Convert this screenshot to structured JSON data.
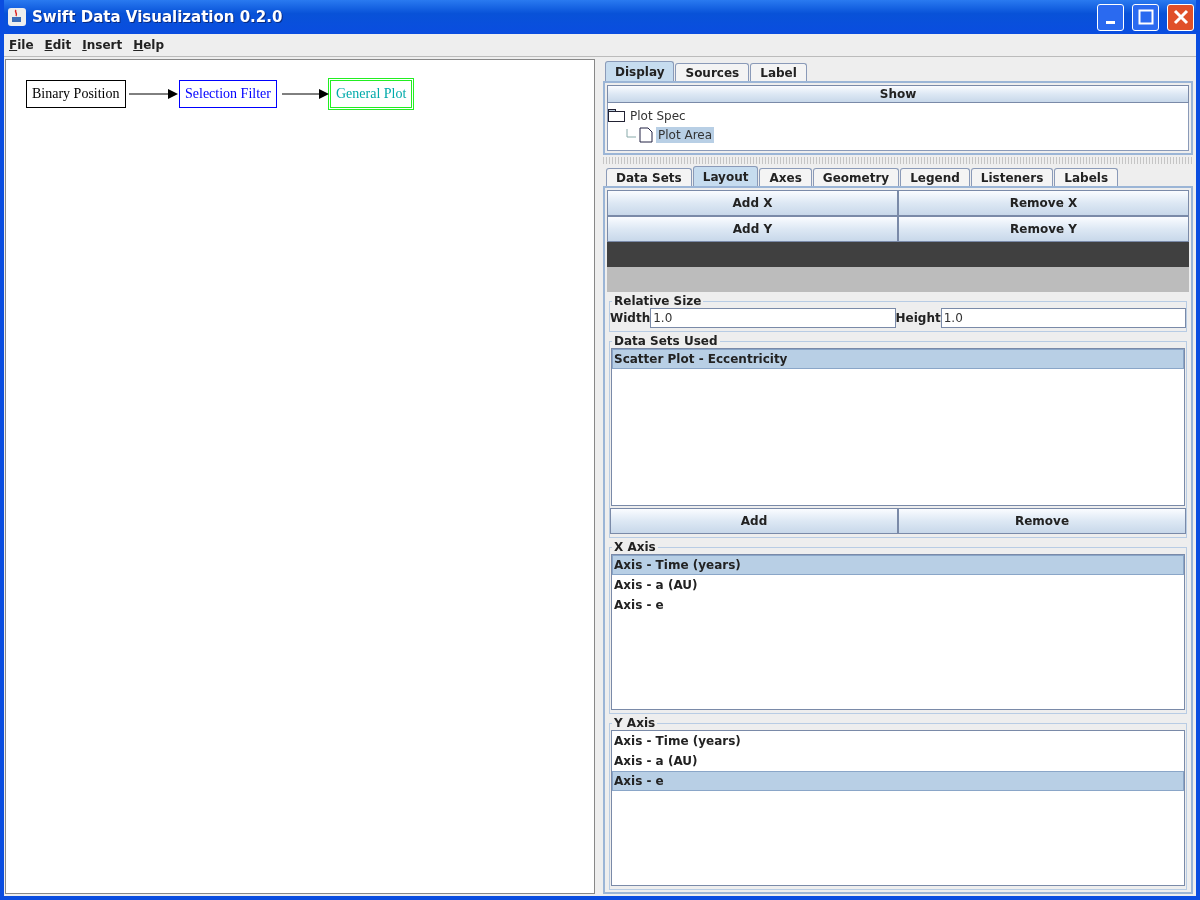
{
  "window": {
    "title": "Swift Data Visualization 0.2.0"
  },
  "menu": [
    "File",
    "Edit",
    "Insert",
    "Help"
  ],
  "diagram": {
    "nodes": [
      {
        "label": "Binary Position",
        "color": "#000000",
        "selected": false
      },
      {
        "label": "Selection Filter",
        "color": "#0000ff",
        "selected": false
      },
      {
        "label": "General Plot",
        "color": "#00aaaa",
        "selected": true
      }
    ]
  },
  "top_tabs": [
    {
      "label": "Display",
      "selected": true
    },
    {
      "label": "Sources",
      "selected": false
    },
    {
      "label": "Label",
      "selected": false
    }
  ],
  "show_button": "Show",
  "tree": [
    {
      "label": "Plot Spec",
      "selected": false,
      "children": [
        {
          "label": "Plot Area",
          "selected": true
        }
      ]
    }
  ],
  "inner_tabs": [
    {
      "label": "Data Sets",
      "selected": false
    },
    {
      "label": "Layout",
      "selected": true
    },
    {
      "label": "Axes",
      "selected": false
    },
    {
      "label": "Geometry",
      "selected": false
    },
    {
      "label": "Legend",
      "selected": false
    },
    {
      "label": "Listeners",
      "selected": false
    },
    {
      "label": "Labels",
      "selected": false
    }
  ],
  "axis_buttons": [
    "Add X",
    "Remove X",
    "Add Y",
    "Remove Y"
  ],
  "relative_size": {
    "title": "Relative Size",
    "fields": [
      {
        "label": "Width",
        "value": "1.0"
      },
      {
        "label": "Height",
        "value": "1.0"
      }
    ]
  },
  "data_sets_used": {
    "title": "Data Sets Used",
    "items": [
      {
        "label": "Scatter Plot - Eccentricity",
        "selected": true
      }
    ],
    "buttons": [
      "Add",
      "Remove"
    ]
  },
  "x_axis": {
    "title": "X Axis",
    "items": [
      {
        "label": "Axis - Time (years)",
        "selected": true
      },
      {
        "label": "Axis - a (AU)",
        "selected": false
      },
      {
        "label": "Axis - e",
        "selected": false
      }
    ]
  },
  "y_axis": {
    "title": "Y Axis",
    "items": [
      {
        "label": "Axis - Time (years)",
        "selected": false
      },
      {
        "label": "Axis - a (AU)",
        "selected": false
      },
      {
        "label": "Axis - e",
        "selected": true
      }
    ]
  }
}
